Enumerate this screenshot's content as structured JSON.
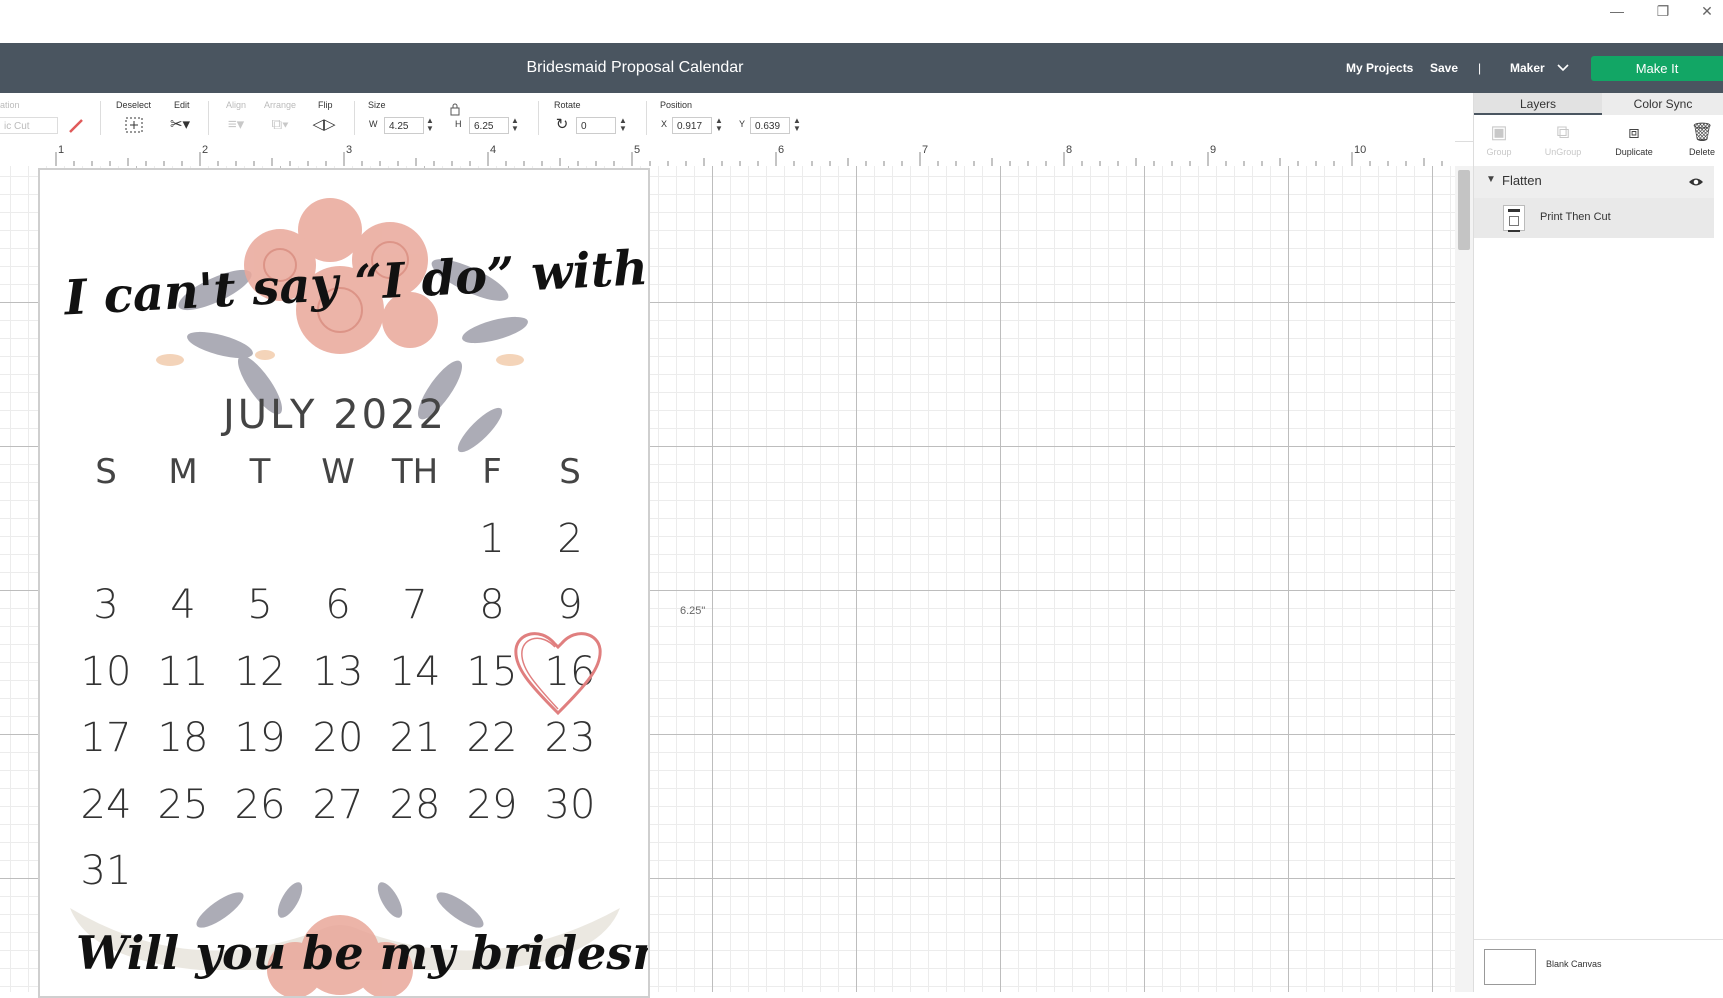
{
  "window": {
    "minimize": "—",
    "restore": "❐",
    "close": "✕"
  },
  "header": {
    "title": "Bridesmaid Proposal Calendar",
    "my_projects": "My Projects",
    "save": "Save",
    "divider": "|",
    "machine": "Maker",
    "make_it": "Make It",
    "accent_color": "#12a665"
  },
  "toolbar": {
    "operation_label": "ation",
    "operation_value": "ic Cut",
    "deselect_label": "Deselect",
    "edit_label": "Edit",
    "align_label": "Align",
    "arrange_label": "Arrange",
    "flip_label": "Flip",
    "size_label": "Size",
    "w_label": "W",
    "w_value": "4.25",
    "h_label": "H",
    "h_value": "6.25",
    "rotate_label": "Rotate",
    "rotate_value": "0",
    "position_label": "Position",
    "x_label": "X",
    "x_value": "0.917",
    "y_label": "Y",
    "y_value": "0.639"
  },
  "ruler": {
    "marks": [
      "1",
      "2",
      "3",
      "4",
      "5",
      "6",
      "7",
      "8",
      "9",
      "10"
    ]
  },
  "canvas": {
    "dimension_label": "6.25\""
  },
  "design": {
    "headline": "I can't say “I do” without you",
    "month": "JULY 2022",
    "weekdays": [
      "S",
      "M",
      "T",
      "W",
      "TH",
      "F",
      "S"
    ],
    "weeks": [
      [
        "",
        "",
        "",
        "",
        "",
        "1",
        "2"
      ],
      [
        "3",
        "4",
        "5",
        "6",
        "7",
        "8",
        "9"
      ],
      [
        "10",
        "11",
        "12",
        "13",
        "14",
        "15",
        "16"
      ],
      [
        "17",
        "18",
        "19",
        "20",
        "21",
        "22",
        "23"
      ],
      [
        "24",
        "25",
        "26",
        "27",
        "28",
        "29",
        "30"
      ],
      [
        "31",
        "",
        "",
        "",
        "",
        "",
        ""
      ]
    ],
    "highlighted_day": "16",
    "question": "Will you be my bridesmaid?"
  },
  "panel": {
    "tab_layers": "Layers",
    "tab_color_sync": "Color Sync",
    "group": "Group",
    "ungroup": "UnGroup",
    "duplicate": "Duplicate",
    "delete": "Delete",
    "flatten": "Flatten",
    "layer_name": "Print Then Cut",
    "blank_canvas": "Blank Canvas"
  }
}
